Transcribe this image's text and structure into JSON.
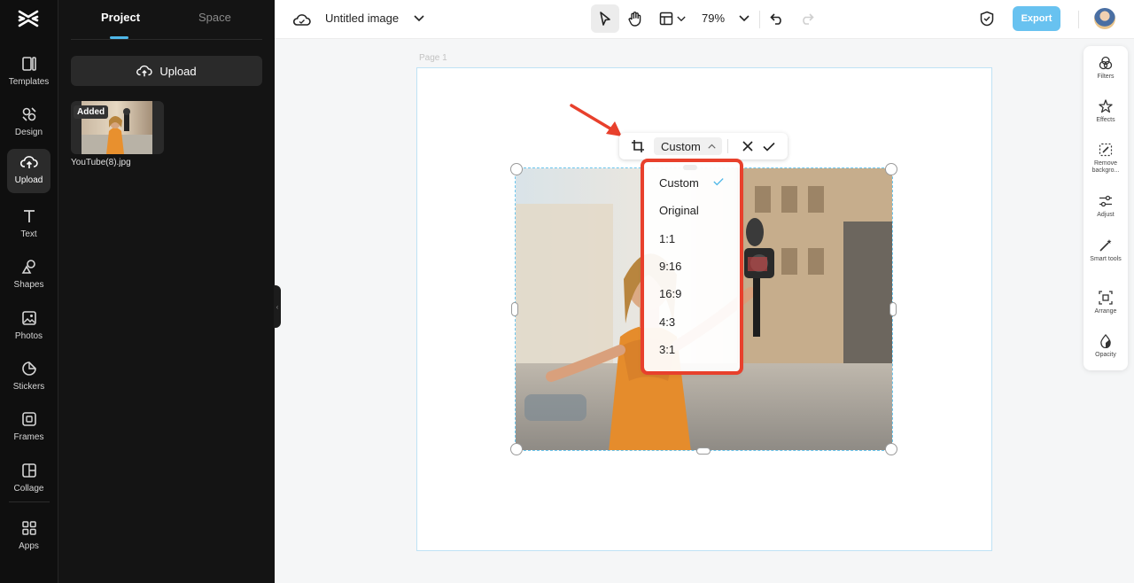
{
  "rail": {
    "items": [
      {
        "label": "Templates",
        "icon": "templates-icon"
      },
      {
        "label": "Design",
        "icon": "design-icon"
      },
      {
        "label": "Upload",
        "icon": "upload-cloud-icon",
        "active": true
      },
      {
        "label": "Text",
        "icon": "text-icon"
      },
      {
        "label": "Shapes",
        "icon": "shapes-icon"
      },
      {
        "label": "Photos",
        "icon": "photos-icon"
      },
      {
        "label": "Stickers",
        "icon": "stickers-icon"
      },
      {
        "label": "Frames",
        "icon": "frames-icon"
      },
      {
        "label": "Collage",
        "icon": "collage-icon"
      },
      {
        "label": "Apps",
        "icon": "apps-icon"
      }
    ]
  },
  "panel": {
    "tabs": [
      {
        "label": "Project"
      },
      {
        "label": "Space"
      }
    ],
    "upload_label": "Upload",
    "file": {
      "badge": "Added",
      "name": "YouTube(8).jpg"
    }
  },
  "topbar": {
    "title": "Untitled image",
    "zoom": "79%",
    "export_label": "Export"
  },
  "canvas": {
    "page_label": "Page 1"
  },
  "crop": {
    "selected": "Custom",
    "options": [
      "Custom",
      "Original",
      "1:1",
      "9:16",
      "16:9",
      "4:3",
      "3:1"
    ]
  },
  "right_rail": {
    "items": [
      {
        "label": "Filters",
        "icon": "filters-icon"
      },
      {
        "label": "Effects",
        "icon": "effects-icon"
      },
      {
        "label": "Remove backgro...",
        "icon": "remove-background-icon"
      },
      {
        "label": "Adjust",
        "icon": "adjust-icon"
      },
      {
        "label": "Smart tools",
        "icon": "smart-tools-icon"
      },
      {
        "label": "Arrange",
        "icon": "arrange-icon"
      },
      {
        "label": "Opacity",
        "icon": "opacity-icon"
      }
    ]
  },
  "colors": {
    "accent": "#4fb7e8",
    "export": "#68c2f0",
    "annotation": "#e8402c"
  }
}
